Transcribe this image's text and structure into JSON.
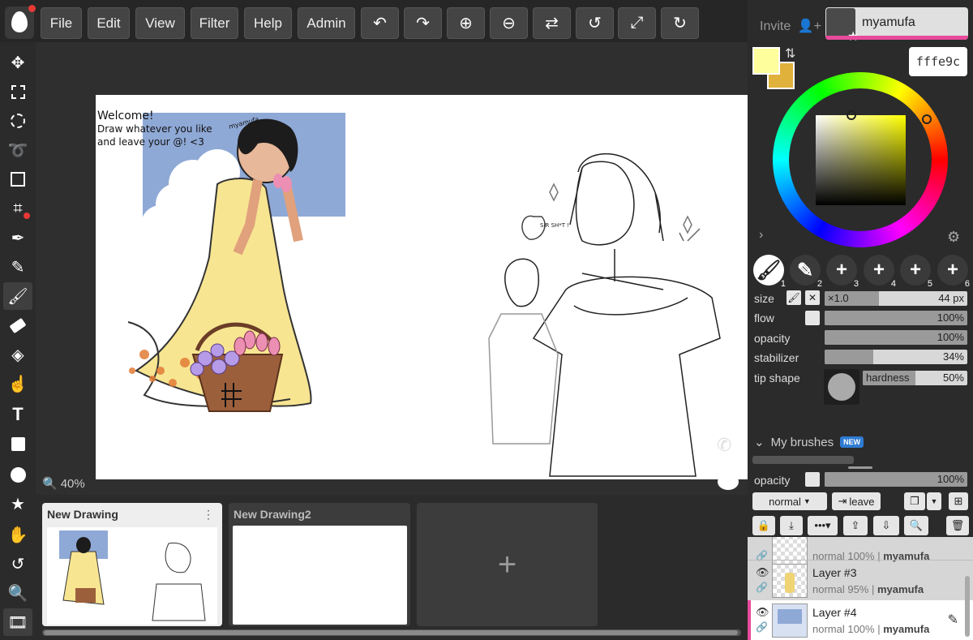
{
  "menu": {
    "file": "File",
    "edit": "Edit",
    "view": "View",
    "filter": "Filter",
    "help": "Help",
    "admin": "Admin"
  },
  "toolbar_icons": [
    "move-icon",
    "rect-select-icon",
    "ellipse-select-icon",
    "lasso-icon",
    "transform-icon",
    "crop-icon",
    "eyedropper-icon",
    "pencil-icon",
    "brush-icon",
    "eraser-icon",
    "bucket-icon",
    "smudge-icon",
    "text-icon",
    "rectangle-icon",
    "circle-icon",
    "star-icon",
    "hand-icon",
    "rotate-icon",
    "zoom-icon",
    "film-icon"
  ],
  "header": {
    "invite": "Invite",
    "username": "myamufa"
  },
  "canvas": {
    "zoom": "40%",
    "note_line1": "Welcome!",
    "note_line2": "Draw whatever you like",
    "note_line3": "and leave your @! <3",
    "note_sign": "myamufa",
    "bubble": "SIR SH*T !"
  },
  "drawings": [
    {
      "title": "New Drawing"
    },
    {
      "title": "New Drawing2"
    }
  ],
  "color": {
    "primary": "#fffe9c",
    "secondary": "#e0b23c",
    "hex": "fffe9c"
  },
  "brush_slots": [
    "1",
    "2",
    "3",
    "4",
    "5",
    "6"
  ],
  "brush": {
    "size_label": "size",
    "size_prefix": "×1.0",
    "size_value": "44 px",
    "size_fraction": 0.38,
    "flow_label": "flow",
    "flow_value": "100%",
    "flow_fraction": 1.0,
    "opacity_label": "opacity",
    "opacity_value": "100%",
    "opacity_fraction": 1.0,
    "stabilizer_label": "stabilizer",
    "stabilizer_value": "34%",
    "stabilizer_fraction": 0.34,
    "tipshape_label": "tip shape",
    "hardness_label": "hardness",
    "hardness_value": "50%",
    "hardness_fraction": 0.5
  },
  "my_brushes": {
    "label": "My brushes",
    "badge": "NEW"
  },
  "layer_panel": {
    "opacity_label": "opacity",
    "opacity_value": "100%",
    "opacity_fraction": 1.0,
    "blend_mode": "normal",
    "leave": "leave"
  },
  "layers": [
    {
      "name": "",
      "blend": "normal 100%",
      "owner": "myamufa"
    },
    {
      "name": "Layer #3",
      "blend": "normal 95%",
      "owner": "myamufa"
    },
    {
      "name": "Layer #4",
      "blend": "normal 100%",
      "owner": "myamufa"
    }
  ]
}
